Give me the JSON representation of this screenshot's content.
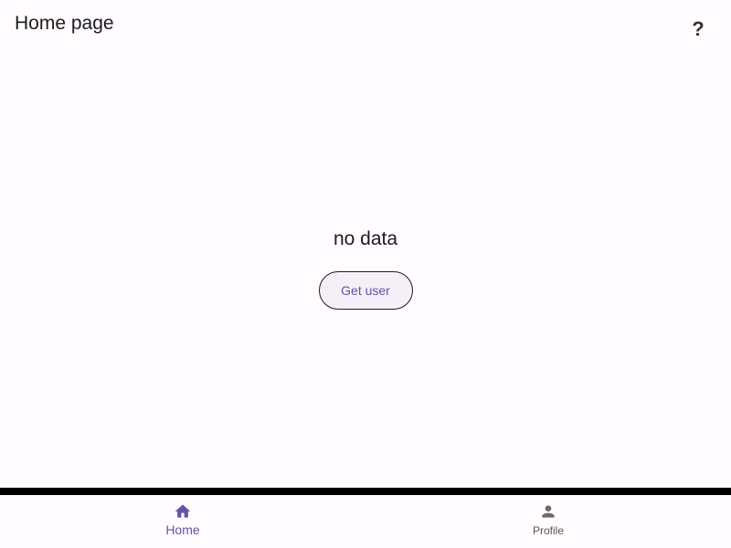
{
  "header": {
    "title": "Home page",
    "help_label": "?"
  },
  "main": {
    "status_text": "no data",
    "get_user_label": "Get user"
  },
  "nav": {
    "items": [
      {
        "label": "Home",
        "icon": "home-icon",
        "selected": true
      },
      {
        "label": "Profile",
        "icon": "person-icon",
        "selected": false
      }
    ]
  },
  "colors": {
    "accent": "#6750a4",
    "inactive": "#6b6b6b",
    "background": "#fffbfe"
  }
}
